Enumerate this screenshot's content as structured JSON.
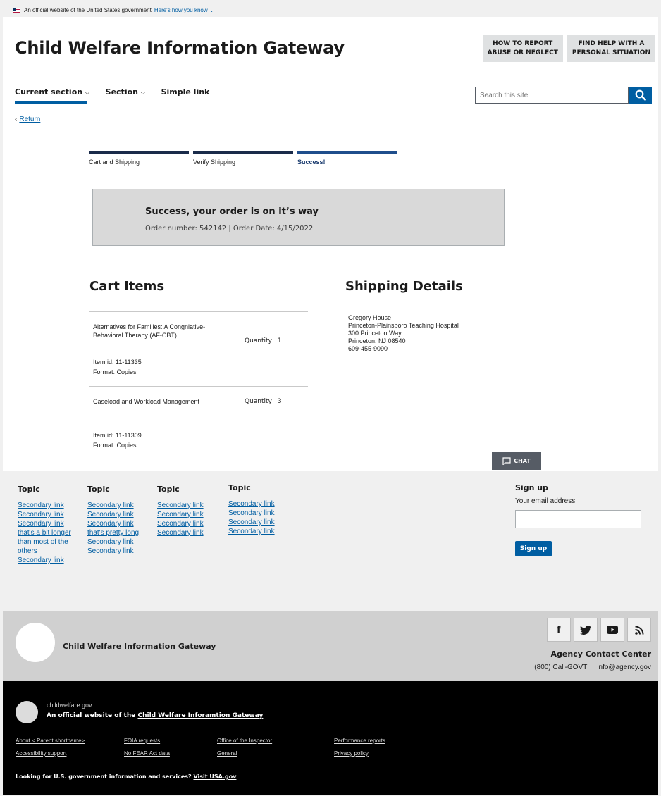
{
  "gov_banner": {
    "text": "An official website of the United States government",
    "link": "Here's how you know ⌄"
  },
  "header": {
    "title": "Child Welfare Information Gateway",
    "buttons": [
      {
        "line1": "HOW TO REPORT",
        "line2": "ABUSE OR NEGLECT"
      },
      {
        "line1": "FIND HELP WITH A",
        "line2": "PERSONAL SITUATION"
      }
    ],
    "nav": [
      {
        "label": "Current section",
        "chevron": "⌵"
      },
      {
        "label": "Section",
        "chevron": "⌵"
      },
      {
        "label": "Simple link"
      }
    ],
    "search_placeholder": "Search this site"
  },
  "return_label": "Return",
  "steps": [
    "Cart and Shipping",
    "Verify Shipping",
    "Success!"
  ],
  "success": {
    "title": "Success, your order is on it’s way",
    "detail": "Order number: 542142 | Order Date: 4/15/2022"
  },
  "cart": {
    "heading": "Cart Items",
    "quantity_label": "Quantity",
    "items": [
      {
        "name": "Alternatives for Families: A Congniative-Behavioral Therapy (AF-CBT)",
        "item_id": "Item id: 11-11335",
        "format": "Format: Copies",
        "qty": "1"
      },
      {
        "name": "Caseload and Workload Management",
        "item_id": "Item id: 11-11309",
        "format": "Format: Copies",
        "qty": "3"
      }
    ]
  },
  "shipping": {
    "heading": "Shipping Details",
    "lines": [
      "Gregory House",
      "Princeton-Plainsboro Teaching Hospital",
      "300 Princeton Way",
      "Princeton, NJ 08540",
      "609-455-9090"
    ]
  },
  "chat_label": "CHAT",
  "footer_links": {
    "columns": [
      {
        "heading": "Topic",
        "links": [
          "Secondary link",
          "Secondary link",
          "Secondary link that's a bit longer than most of the others",
          "Secondary link"
        ]
      },
      {
        "heading": "Topic",
        "links": [
          "Secondary link",
          "Secondary link",
          "Secondary link that's pretty long",
          "Secondary link",
          "Secondary link"
        ]
      },
      {
        "heading": "Topic",
        "links": [
          "Secondary link",
          "Secondary link",
          "Secondary link",
          "Secondary link"
        ]
      },
      {
        "heading": "Topic",
        "links": [
          "Secondary link",
          "Secondary link",
          "Secondary link",
          "Secondary link"
        ]
      }
    ],
    "signup": {
      "heading": "Sign up",
      "label": "Your email address",
      "button": "Sign up"
    }
  },
  "footer_brand": {
    "title": "Child Welfare Information Gateway",
    "social_icons": [
      "facebook-icon",
      "twitter-icon",
      "youtube-icon",
      "rss-icon"
    ],
    "contact_heading": "Agency Contact Center",
    "phone": "(800) Call-GOVT",
    "email": "info@agency.gov"
  },
  "identifier": {
    "domain": "childwelfare.gov",
    "official_prefix": "An official website of the",
    "official_link": "Child Welfare Inforamtion Gateway",
    "links": [
      "About < Parent shortname>",
      "FOIA requests",
      "Office of the Inspector",
      "Performance reports",
      "Accessibility support",
      "No FEAR Act data",
      "General",
      "Privacy policy"
    ],
    "usa_prefix": "Looking for U.S. government information and services?",
    "usa_link": "Visit USA.gov"
  }
}
